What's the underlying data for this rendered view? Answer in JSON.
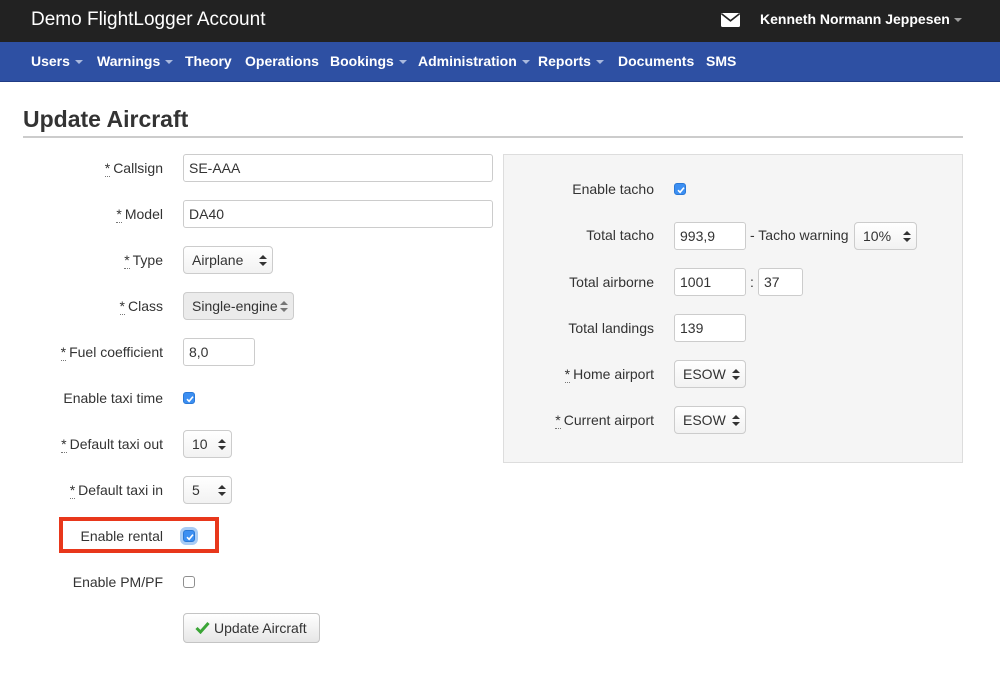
{
  "header": {
    "brand": "Demo FlightLogger Account",
    "mail_icon": "envelope-icon",
    "user_name": "Kenneth Normann Jeppesen"
  },
  "nav": {
    "users": "Users",
    "warnings": "Warnings",
    "theory": "Theory",
    "operations": "Operations",
    "bookings": "Bookings",
    "administration": "Administration",
    "reports": "Reports",
    "documents": "Documents",
    "sms": "SMS"
  },
  "page": {
    "title": "Update Aircraft"
  },
  "form": {
    "required_mark": "*",
    "callsign": {
      "label": "Callsign",
      "value": "SE-AAA"
    },
    "model": {
      "label": "Model",
      "value": "DA40"
    },
    "type": {
      "label": "Type",
      "value": "Airplane"
    },
    "class": {
      "label": "Class",
      "value": "Single-engine"
    },
    "fuel_coefficient": {
      "label": "Fuel coefficient",
      "value": "8,0"
    },
    "enable_taxi_time": {
      "label": "Enable taxi time",
      "checked": true
    },
    "default_taxi_out": {
      "label": "Default taxi out",
      "value": "10"
    },
    "default_taxi_in": {
      "label": "Default taxi in",
      "value": "5"
    },
    "enable_rental": {
      "label": "Enable rental",
      "checked": true
    },
    "enable_pm_pf": {
      "label": "Enable PM/PF",
      "checked": false
    },
    "submit": {
      "label": "Update Aircraft",
      "icon": "check-icon"
    }
  },
  "panel": {
    "enable_tacho": {
      "label": "Enable tacho",
      "checked": true
    },
    "total_tacho": {
      "label": "Total tacho",
      "value": "993,9"
    },
    "tacho_warning": {
      "label": "- Tacho warning",
      "value": "10%"
    },
    "total_airborne": {
      "label": "Total airborne",
      "hours": "1001",
      "separator": ":",
      "minutes": "37"
    },
    "total_landings": {
      "label": "Total landings",
      "value": "139"
    },
    "home_airport": {
      "label": "Home airport",
      "value": "ESOW"
    },
    "current_airport": {
      "label": "Current airport",
      "value": "ESOW"
    }
  },
  "colors": {
    "topbar": "#222222",
    "navbar": "#2e50a3",
    "checkbox_checked": "#3c8ff2",
    "highlight": "#e8371b",
    "check_icon": "#3aa536"
  }
}
